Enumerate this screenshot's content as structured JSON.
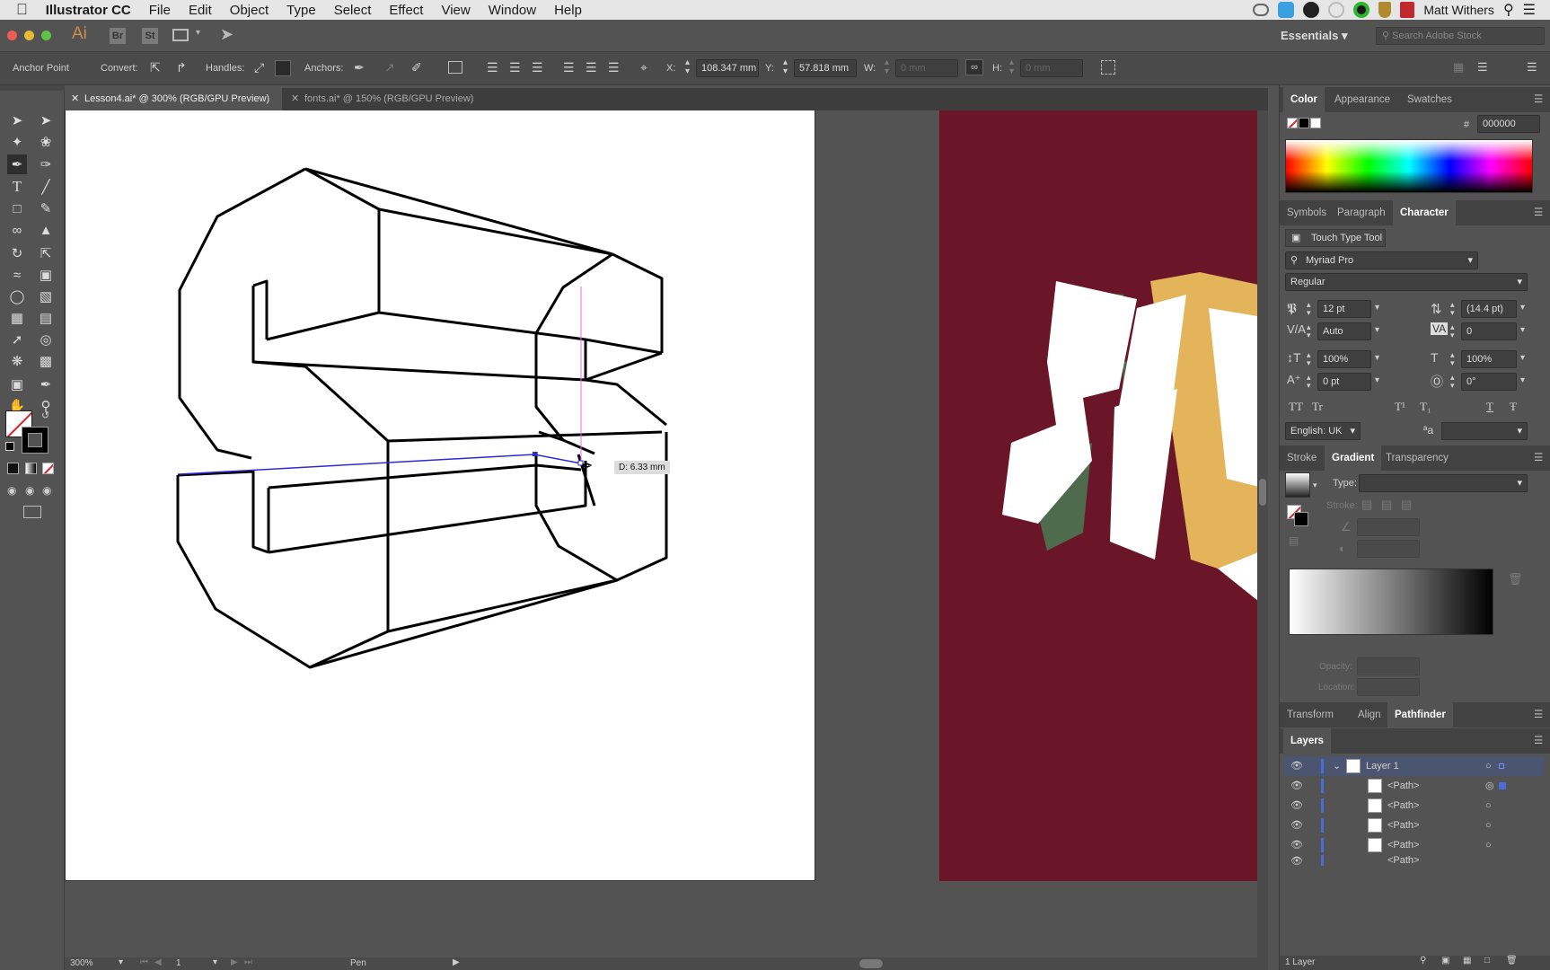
{
  "menubar": {
    "app": "Illustrator CC",
    "items": [
      "File",
      "Edit",
      "Object",
      "Type",
      "Select",
      "Effect",
      "View",
      "Window",
      "Help"
    ],
    "user": "Matt Withers"
  },
  "appbar": {
    "logo": "Ai",
    "br": "Br",
    "st": "St",
    "workspace": "Essentials",
    "search_placeholder": "Search Adobe Stock"
  },
  "control": {
    "mode": "Anchor Point",
    "convert": "Convert:",
    "handles": "Handles:",
    "anchors": "Anchors:",
    "x_label": "X:",
    "x_value": "108.347 mm",
    "y_label": "Y:",
    "y_value": "57.818 mm",
    "w_label": "W:",
    "w_value": "0 mm",
    "h_label": "H:",
    "h_value": "0 mm"
  },
  "tabs": [
    {
      "label": "Lesson4.ai* @ 300% (RGB/GPU Preview)",
      "active": true
    },
    {
      "label": "fonts.ai* @ 150% (RGB/GPU Preview)",
      "active": false
    }
  ],
  "canvas": {
    "measure": "D: 6.33 mm",
    "artboard2_color": "#6b1628",
    "art_colors": [
      "#ffffff",
      "#e4b45a",
      "#4e6b4e"
    ]
  },
  "status": {
    "zoom": "300%",
    "page": "1",
    "tool": "Pen"
  },
  "color_panel": {
    "tabs": [
      "Color",
      "Appearance",
      "Swatches"
    ],
    "hex_label": "#",
    "hex": "000000"
  },
  "character_panel": {
    "tabs": [
      "Symbols",
      "Paragraph",
      "Character"
    ],
    "touch_type": "Touch Type Tool",
    "font": "Myriad Pro",
    "style": "Regular",
    "size": "12 pt",
    "leading": "(14.4 pt)",
    "kerning": "Auto",
    "tracking": "0",
    "vscale": "100%",
    "hscale": "100%",
    "baseline": "0 pt",
    "rotation": "0°",
    "tt_caps": "TT",
    "tt_small": "Tr",
    "tt_super": "T¹",
    "tt_sub": "T₁",
    "tt_under": "T",
    "tt_strike": "Ŧ",
    "language": "English: UK",
    "aa": "ªa"
  },
  "gradient_panel": {
    "tabs": [
      "Stroke",
      "Gradient",
      "Transparency"
    ],
    "type_label": "Type:",
    "stroke_label": "Stroke:",
    "opacity_label": "Opacity:",
    "location_label": "Location:"
  },
  "transform_panel": {
    "tabs": [
      "Transform",
      "Align",
      "Pathfinder"
    ]
  },
  "layers_panel": {
    "title": "Layers",
    "layer": "Layer 1",
    "items": [
      "<Path>",
      "<Path>",
      "<Path>",
      "<Path>",
      "<Path>"
    ],
    "footer": "1 Layer"
  }
}
